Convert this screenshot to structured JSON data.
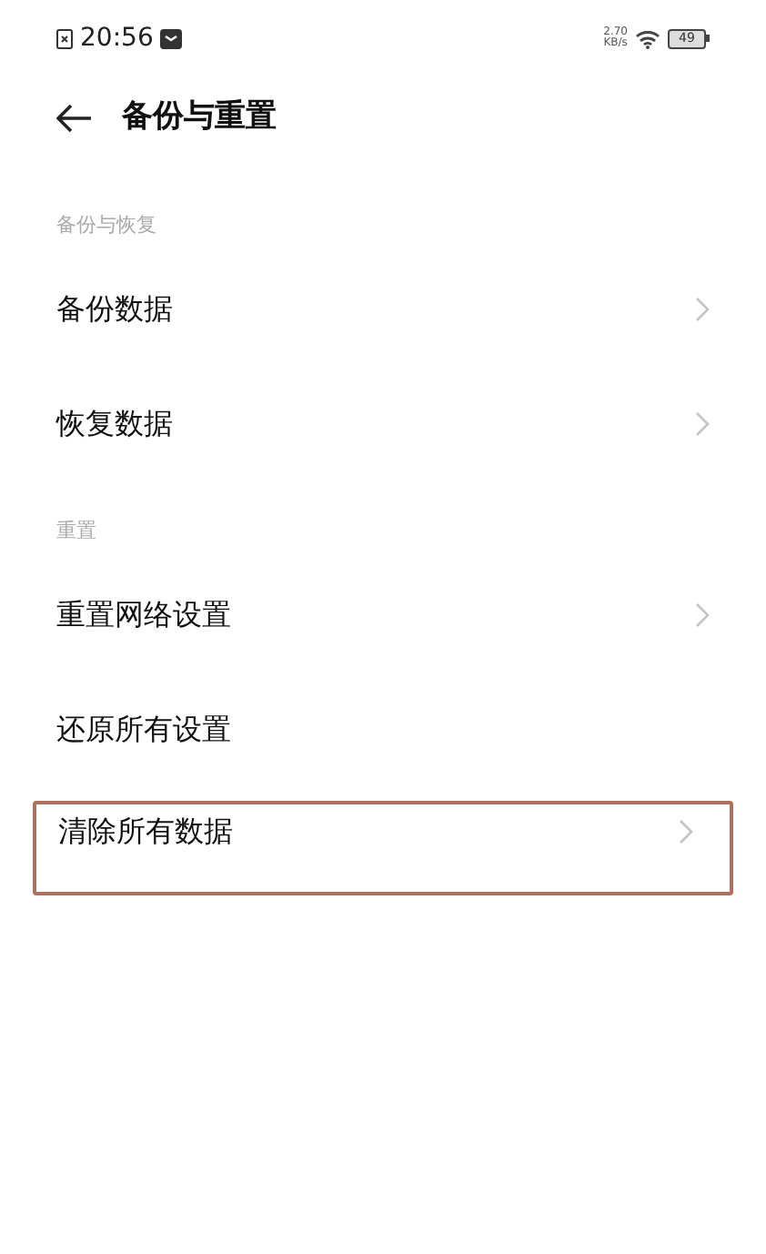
{
  "status_bar": {
    "time": "20:56",
    "speed": "2.70",
    "speed_unit": "KB/s",
    "battery": "49"
  },
  "header": {
    "title": "备份与重置"
  },
  "sections": [
    {
      "title": "备份与恢复",
      "items": [
        {
          "label": "备份数据",
          "chevron": true,
          "highlighted": false
        },
        {
          "label": "恢复数据",
          "chevron": true,
          "highlighted": false
        }
      ]
    },
    {
      "title": "重置",
      "items": [
        {
          "label": "重置网络设置",
          "chevron": true,
          "highlighted": false
        },
        {
          "label": "还原所有设置",
          "chevron": false,
          "highlighted": false
        },
        {
          "label": "清除所有数据",
          "chevron": true,
          "highlighted": true
        }
      ]
    }
  ]
}
